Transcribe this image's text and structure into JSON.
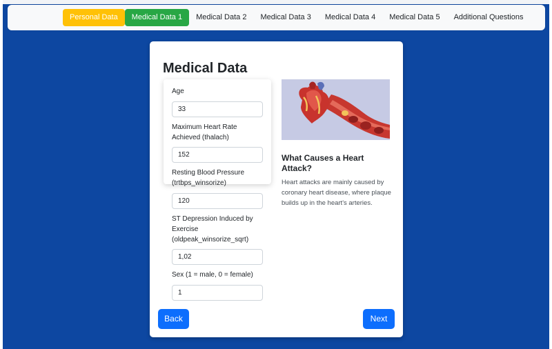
{
  "nav": {
    "tabs": [
      {
        "label": "Personal Data"
      },
      {
        "label": "Medical Data 1"
      },
      {
        "label": "Medical Data 2"
      },
      {
        "label": "Medical Data 3"
      },
      {
        "label": "Medical Data 4"
      },
      {
        "label": "Medical Data 5"
      },
      {
        "label": "Additional Questions"
      }
    ]
  },
  "card": {
    "title": "Medical Data",
    "fields": [
      {
        "label": "Age",
        "value": "33"
      },
      {
        "label": "Maximum Heart Rate Achieved (thalach)",
        "value": "152"
      },
      {
        "label": "Resting Blood Pressure (trtbps_winsorize)",
        "value": "120"
      },
      {
        "label": "ST Depression Induced by Exercise (oldpeak_winsorize_sqrt)",
        "value": "1,02"
      },
      {
        "label": "Sex (1 = male, 0 = female)",
        "value": "1"
      }
    ],
    "info": {
      "title": "What Causes a Heart Attack?",
      "body": "Heart attacks are mainly caused by coronary heart disease, where plaque builds up in the heart's arteries."
    },
    "back_label": "Back",
    "next_label": "Next"
  },
  "colors": {
    "page_background": "#0d47a1",
    "tab_personal": "#ffc107",
    "tab_active": "#28a745",
    "primary_button": "#0d6efd"
  }
}
